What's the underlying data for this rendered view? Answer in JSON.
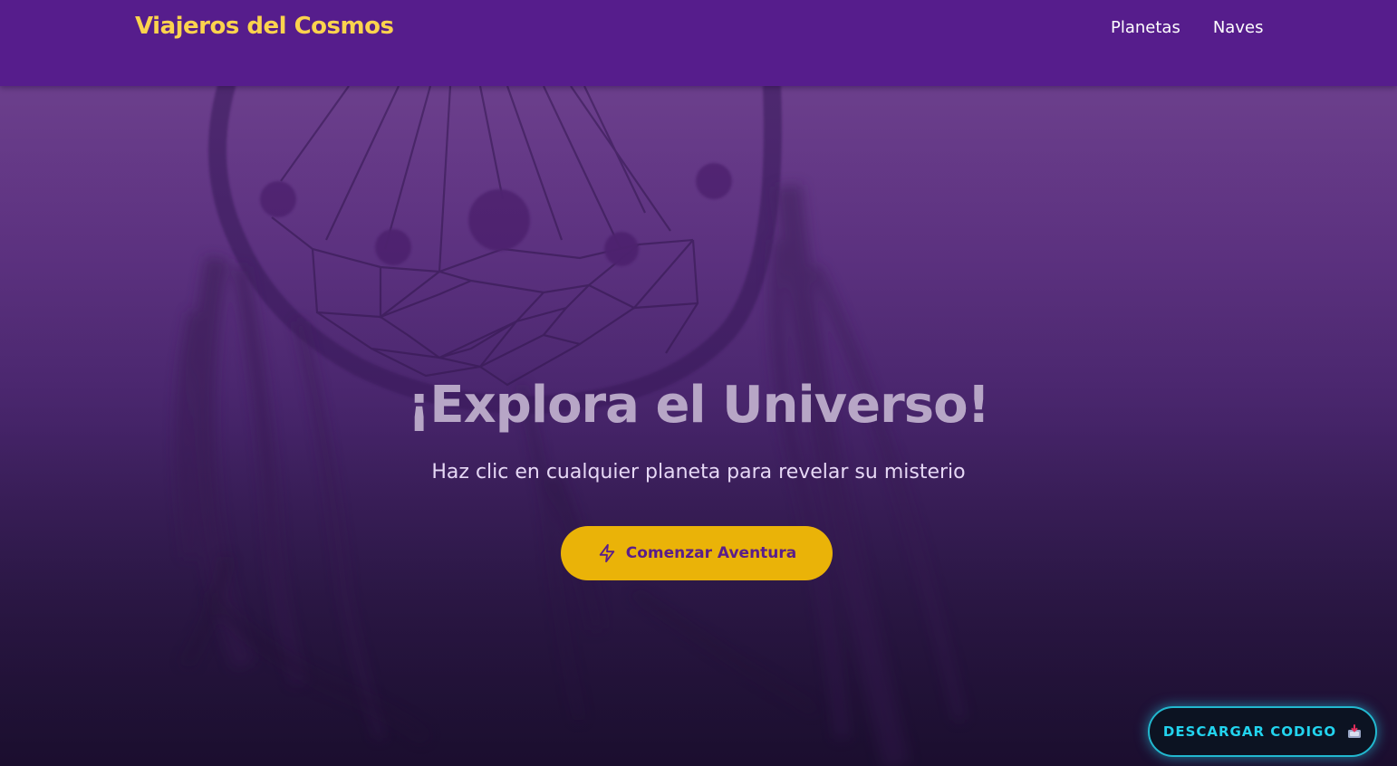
{
  "header": {
    "brand": "Viajeros del Cosmos",
    "nav": [
      {
        "label": "Planetas"
      },
      {
        "label": "Naves"
      }
    ]
  },
  "hero": {
    "background_image": "dreamcatcher-image",
    "title": "¡Explora el Universo!",
    "subtitle": "Haz clic en cualquier planeta para revelar su misterio",
    "cta": {
      "label": "Comenzar Aventura",
      "icon": "lightning-bolt-icon"
    }
  },
  "download_button": {
    "label": "DESCARGAR CODIGO",
    "icon": "inbox-tray-icon"
  },
  "colors": {
    "header_bg": "#561d8c",
    "brand_text": "#fcd34d",
    "cta_bg": "#eab308",
    "cta_text": "#5b1e8a",
    "download_border": "#22b8cf",
    "download_text": "#22d3ee"
  }
}
